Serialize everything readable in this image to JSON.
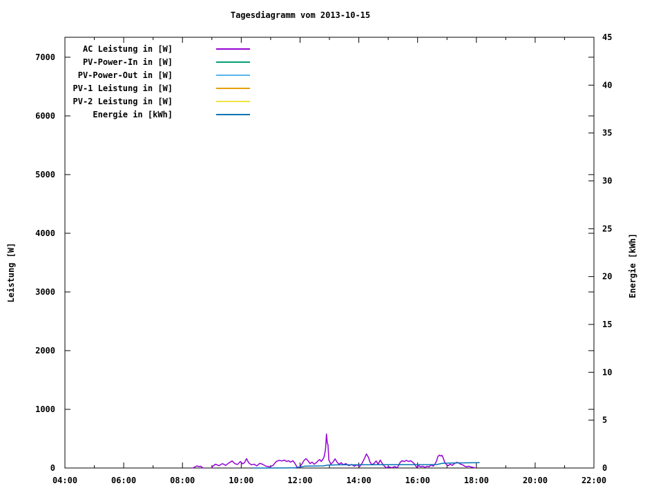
{
  "chart_data": {
    "type": "line",
    "title": "Tagesdiagramm vom 2013-10-15",
    "xlabel": "",
    "ylabel": "Leistung [W]",
    "y2label": "Energie [kWh]",
    "background_color": "#ffffff",
    "border_color": "#000000",
    "grid": "off",
    "legend_position": "top-left-inside",
    "x_axis": {
      "unit": "time of day",
      "range_hours": [
        4,
        22
      ],
      "major_tick_every_hours": 2,
      "minor_tick_every_hours": 1,
      "tick_labels": [
        "04:00",
        "06:00",
        "08:00",
        "10:00",
        "12:00",
        "14:00",
        "16:00",
        "18:00",
        "20:00",
        "22:00"
      ]
    },
    "y_axis": {
      "label": "Leistung [W]",
      "range": [
        0,
        7340
      ],
      "tick_values": [
        0,
        1000,
        2000,
        3000,
        4000,
        5000,
        6000,
        7000
      ],
      "tick_labels": [
        "0",
        "1000",
        "2000",
        "3000",
        "4000",
        "5000",
        "6000",
        "7000"
      ]
    },
    "y2_axis": {
      "label": "Energie [kWh]",
      "range": [
        0,
        45
      ],
      "tick_values": [
        0,
        5,
        10,
        15,
        20,
        25,
        30,
        35,
        40,
        45
      ],
      "tick_labels": [
        "0",
        "5",
        "10",
        "15",
        "20",
        "25",
        "30",
        "35",
        "40",
        "45"
      ]
    },
    "series": [
      {
        "label": "AC Leistung in [W]",
        "color": "#9400d3",
        "axis": "y1",
        "points": [
          [
            8.35,
            0
          ],
          [
            8.42,
            18
          ],
          [
            8.49,
            35
          ],
          [
            8.56,
            25
          ],
          [
            8.62,
            30
          ],
          [
            8.68,
            5
          ],
          [
            8.72,
            0
          ],
          null,
          [
            9.0,
            0
          ],
          [
            9.02,
            25
          ],
          [
            9.12,
            65
          ],
          [
            9.24,
            40
          ],
          [
            9.36,
            75
          ],
          [
            9.47,
            45
          ],
          [
            9.59,
            90
          ],
          [
            9.69,
            120
          ],
          [
            9.78,
            75
          ],
          [
            9.87,
            60
          ],
          [
            9.97,
            110
          ],
          [
            10.05,
            70
          ],
          [
            10.11,
            90
          ],
          [
            10.18,
            160
          ],
          [
            10.25,
            90
          ],
          [
            10.34,
            55
          ],
          [
            10.44,
            65
          ],
          [
            10.53,
            35
          ],
          [
            10.63,
            80
          ],
          [
            10.72,
            65
          ],
          [
            10.84,
            30
          ],
          [
            10.96,
            20
          ],
          [
            11.07,
            40
          ],
          [
            11.19,
            110
          ],
          [
            11.29,
            130
          ],
          [
            11.38,
            120
          ],
          [
            11.47,
            135
          ],
          [
            11.54,
            110
          ],
          [
            11.61,
            125
          ],
          [
            11.68,
            100
          ],
          [
            11.76,
            125
          ],
          [
            11.83,
            75
          ],
          [
            11.9,
            15
          ],
          [
            11.97,
            5
          ],
          [
            12.06,
            65
          ],
          [
            12.13,
            125
          ],
          [
            12.2,
            160
          ],
          [
            12.27,
            125
          ],
          [
            12.34,
            75
          ],
          [
            12.41,
            100
          ],
          [
            12.48,
            65
          ],
          [
            12.55,
            90
          ],
          [
            12.62,
            125
          ],
          [
            12.67,
            145
          ],
          [
            12.72,
            110
          ],
          [
            12.76,
            135
          ],
          [
            12.81,
            180
          ],
          [
            12.84,
            240
          ],
          [
            12.87,
            340
          ],
          [
            12.9,
            580
          ],
          [
            12.93,
            420
          ],
          [
            12.95,
            400
          ],
          [
            12.98,
            140
          ],
          [
            13.05,
            65
          ],
          [
            13.12,
            100
          ],
          [
            13.19,
            155
          ],
          [
            13.26,
            100
          ],
          [
            13.33,
            65
          ],
          [
            13.4,
            90
          ],
          [
            13.47,
            55
          ],
          [
            13.56,
            75
          ],
          [
            13.66,
            40
          ],
          [
            13.75,
            60
          ],
          [
            13.85,
            30
          ],
          [
            13.94,
            55
          ],
          [
            14.03,
            25
          ],
          [
            14.12,
            90
          ],
          [
            14.19,
            160
          ],
          [
            14.26,
            240
          ],
          [
            14.33,
            180
          ],
          [
            14.38,
            100
          ],
          [
            14.45,
            55
          ],
          [
            14.52,
            80
          ],
          [
            14.59,
            120
          ],
          [
            14.66,
            65
          ],
          [
            14.73,
            135
          ],
          [
            14.8,
            75
          ],
          [
            14.87,
            30
          ],
          [
            14.94,
            5
          ],
          [
            15.03,
            20
          ],
          [
            15.12,
            5
          ],
          [
            15.22,
            25
          ],
          [
            15.31,
            5
          ],
          [
            15.41,
            100
          ],
          [
            15.48,
            125
          ],
          [
            15.55,
            110
          ],
          [
            15.62,
            130
          ],
          [
            15.69,
            110
          ],
          [
            15.76,
            125
          ],
          [
            15.83,
            100
          ],
          [
            15.9,
            65
          ],
          [
            15.97,
            10
          ],
          [
            16.04,
            40
          ],
          [
            16.11,
            20
          ],
          [
            16.18,
            30
          ],
          [
            16.25,
            10
          ],
          [
            16.32,
            30
          ],
          [
            16.39,
            20
          ],
          [
            16.46,
            55
          ],
          [
            16.53,
            30
          ],
          [
            16.6,
            75
          ],
          [
            16.65,
            125
          ],
          [
            16.69,
            195
          ],
          [
            16.74,
            220
          ],
          [
            16.79,
            205
          ],
          [
            16.83,
            215
          ],
          [
            16.88,
            160
          ],
          [
            16.92,
            100
          ],
          [
            16.97,
            65
          ],
          [
            17.04,
            40
          ],
          [
            17.11,
            65
          ],
          [
            17.18,
            45
          ],
          [
            17.25,
            75
          ],
          [
            17.32,
            95
          ],
          [
            17.39,
            90
          ],
          [
            17.46,
            65
          ],
          [
            17.53,
            55
          ],
          [
            17.6,
            30
          ],
          [
            17.67,
            20
          ],
          [
            17.74,
            30
          ],
          [
            17.81,
            20
          ],
          [
            17.88,
            10
          ],
          [
            17.95,
            5
          ]
        ]
      },
      {
        "label": "PV-Power-In in [W]",
        "color": "#009e73",
        "axis": "y1",
        "points": []
      },
      {
        "label": "PV-Power-Out in [W]",
        "color": "#56b4e9",
        "axis": "y1",
        "points": []
      },
      {
        "label": "PV-1 Leistung in [W]",
        "color": "#e69f00",
        "axis": "y1",
        "points": []
      },
      {
        "label": "PV-2 Leistung in [W]",
        "color": "#f0e442",
        "axis": "y1",
        "points": []
      },
      {
        "label": "Energie in [kWh]",
        "color": "#0072b2",
        "axis": "y2",
        "points": [
          [
            10.43,
            0.0
          ],
          [
            11.5,
            0.01
          ],
          [
            11.85,
            0.03
          ],
          [
            11.95,
            0.1
          ],
          [
            12.05,
            0.12
          ],
          [
            12.18,
            0.2
          ],
          [
            12.8,
            0.22
          ],
          [
            12.95,
            0.3
          ],
          [
            13.3,
            0.33
          ],
          [
            14.5,
            0.34
          ],
          [
            16.65,
            0.36
          ],
          [
            16.85,
            0.5
          ],
          [
            17.2,
            0.53
          ],
          [
            18.1,
            0.56
          ]
        ]
      }
    ]
  }
}
